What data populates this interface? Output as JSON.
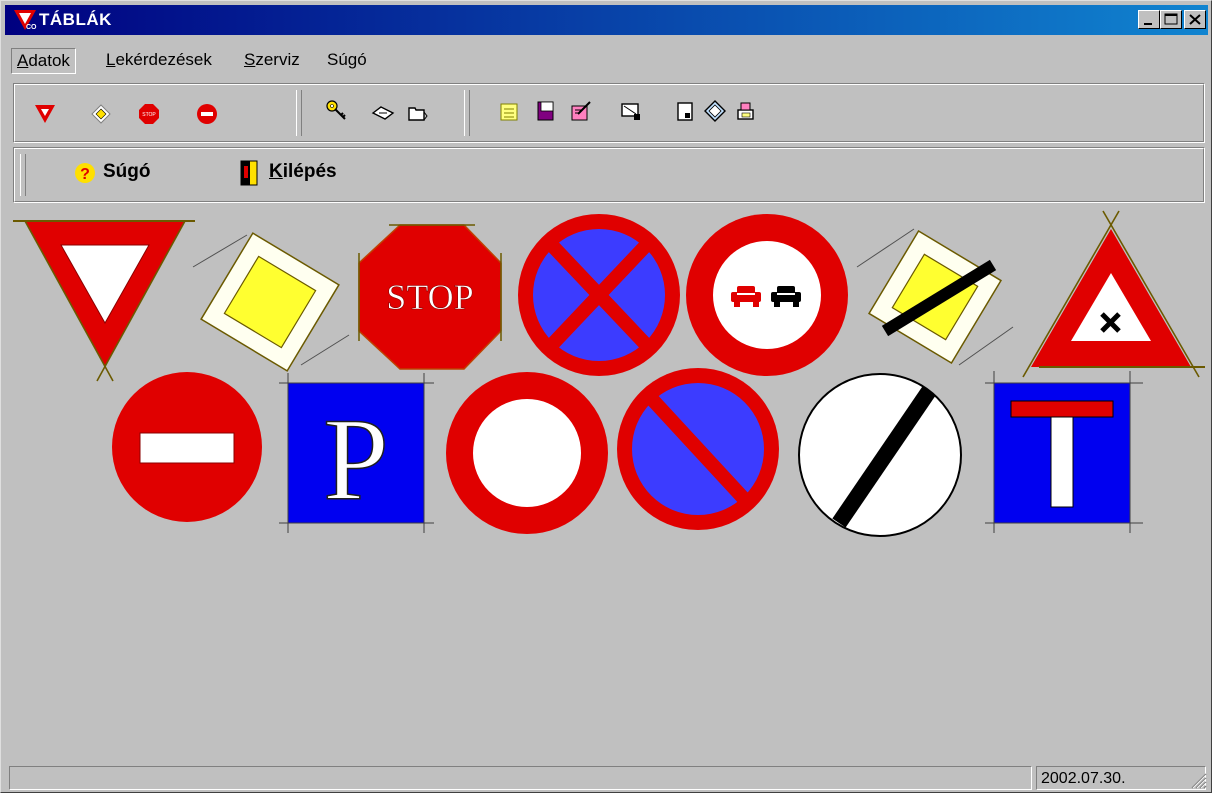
{
  "window": {
    "title": "TÁBLÁK"
  },
  "menu": [
    {
      "label_ul": "A",
      "label_rest": "datok"
    },
    {
      "label_ul": "L",
      "label_rest": "ekérdezések"
    },
    {
      "label_ul": "S",
      "label_rest": "zerviz"
    },
    {
      "label_ul": "",
      "label_rest": "Súgó"
    }
  ],
  "toolbar_icons": {
    "group1": [
      "yield-sign-icon",
      "priority-road-icon",
      "stop-sign-icon",
      "no-entry-icon"
    ],
    "group2": [
      "key-icon",
      "eraser-icon",
      "folder-icon"
    ],
    "group3": [
      "note-icon",
      "notebook-icon",
      "edit-icon",
      "search-doc-icon",
      "document-icon",
      "tag-icon",
      "printer-icon"
    ]
  },
  "commands": {
    "help": {
      "label": "Súgó"
    },
    "exit": {
      "label_ul": "K",
      "label_rest": "ilépés"
    }
  },
  "signs": {
    "stop_text": "STOP",
    "parking_text": "P"
  },
  "status": {
    "date": "2002.07.30."
  }
}
